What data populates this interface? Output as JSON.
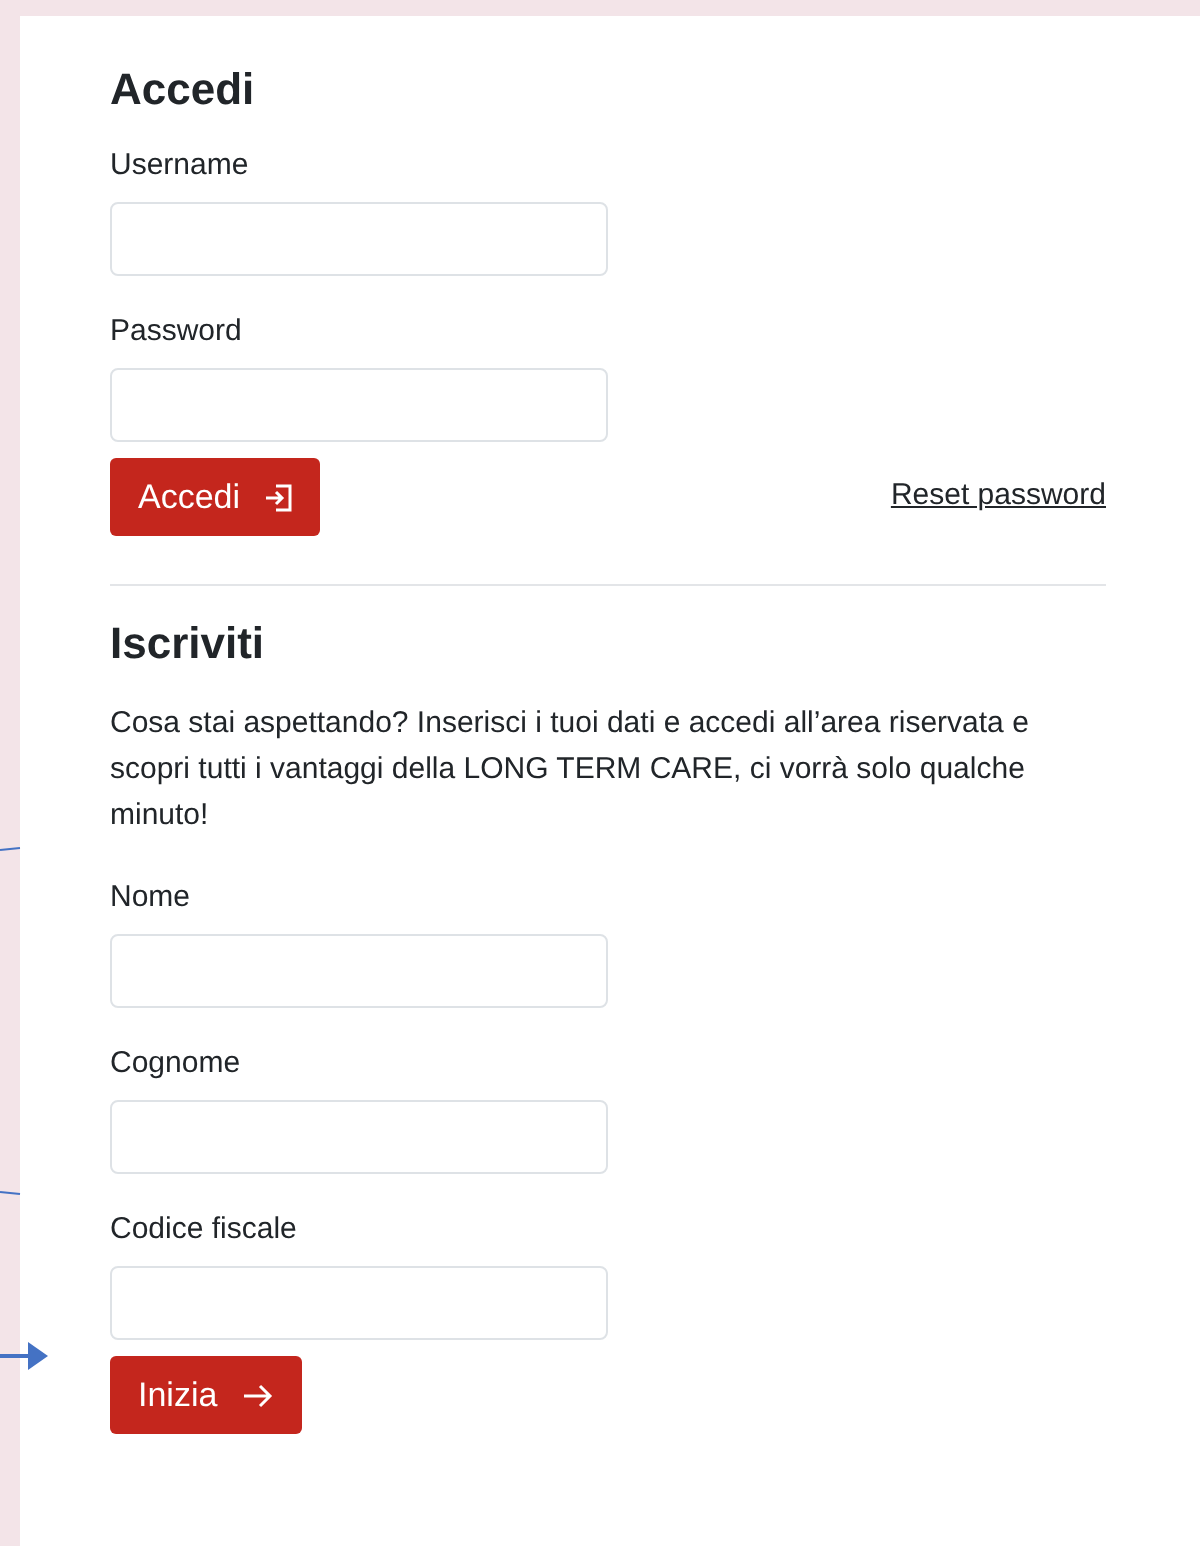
{
  "login": {
    "title": "Accedi",
    "fields": [
      {
        "label": "Username"
      },
      {
        "label": "Password"
      }
    ],
    "button": {
      "label": "Accedi",
      "kind": "login"
    },
    "link": "Reset password"
  },
  "signup": {
    "title": "Iscriviti",
    "text": "Cosa stai aspettando? Inserisci i tuoi dati e accedi all’area riservata e scopri tutti i vantaggi della LONG TERM CARE, ci vorrà solo qualche minuto!",
    "fields": [
      {
        "label": "Nome"
      },
      {
        "label": "Cognome"
      },
      {
        "label": "Codice fiscale"
      }
    ],
    "button": {
      "label": "Inizia",
      "kind": "arrow"
    }
  }
}
